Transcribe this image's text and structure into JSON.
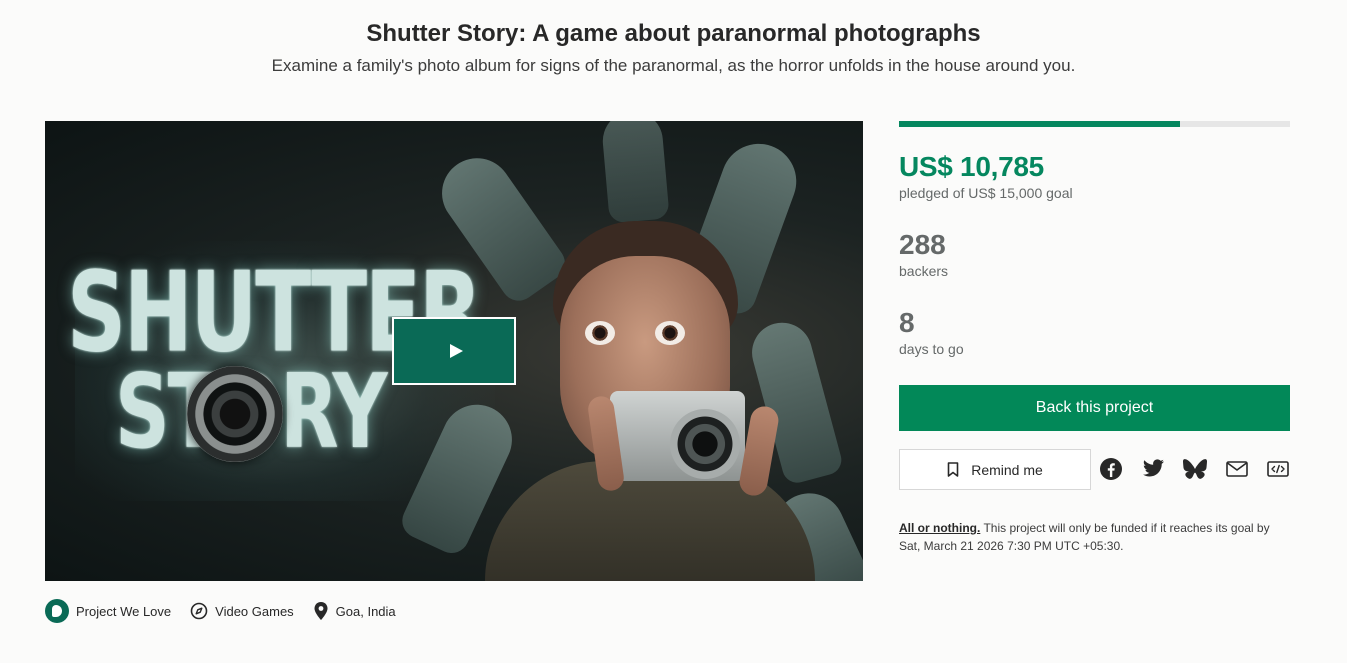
{
  "project": {
    "title": "Shutter Story: A game about paranormal photographs",
    "subtitle": "Examine a family's photo album for signs of the paranormal, as the horror unfolds in the house around you."
  },
  "media": {
    "logo_line1": "SHUTTER",
    "logo_line2": "STORY"
  },
  "campaign": {
    "progress_fraction": 0.719,
    "pledged": "US$ 10,785",
    "pledged_sub": "pledged of US$ 15,000 goal",
    "backers_count": "288",
    "backers_label": "backers",
    "days_count": "8",
    "days_label": "days to go",
    "back_button": "Back this project",
    "remind_button": "Remind me",
    "aon_link": "All or nothing.",
    "aon_text": " This project will only be funded if it reaches its goal by Sat, March 21 2026 7:30 PM UTC +05:30."
  },
  "tags": [
    {
      "label": "Project We Love",
      "icon": "project-we-love-icon"
    },
    {
      "label": "Video Games",
      "icon": "compass-icon"
    },
    {
      "label": "Goa, India",
      "icon": "location-pin-icon"
    }
  ],
  "share_icons": [
    "facebook-icon",
    "twitter-icon",
    "bluesky-icon",
    "email-icon",
    "embed-icon"
  ],
  "colors": {
    "accent_green": "#05875f",
    "button_green": "#028858",
    "badge_green": "#0a6a56"
  }
}
